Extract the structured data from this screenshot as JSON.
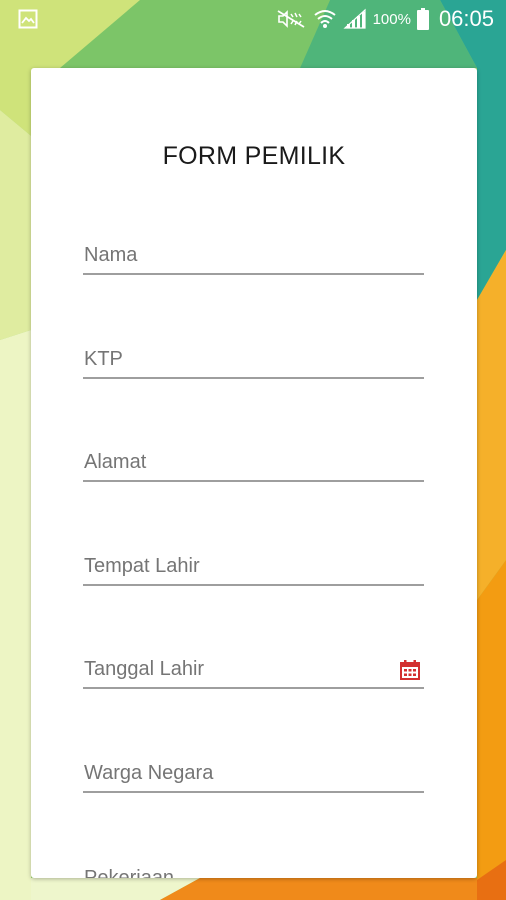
{
  "status_bar": {
    "battery_percent": "100%",
    "time": "06:05"
  },
  "form": {
    "title": "FORM PEMILIK",
    "fields": [
      {
        "placeholder": "Nama"
      },
      {
        "placeholder": "KTP"
      },
      {
        "placeholder": "Alamat"
      },
      {
        "placeholder": "Tempat Lahir"
      },
      {
        "placeholder": "Tanggal Lahir"
      },
      {
        "placeholder": "Warga Negara"
      },
      {
        "placeholder": "Pekerjaan"
      }
    ]
  },
  "icons": {
    "status_left": "image-notification-icon",
    "mute": "mute-icon",
    "wifi": "wifi-icon",
    "signal": "signal-icon",
    "battery": "battery-icon",
    "date_picker": "calendar-icon"
  },
  "colors": {
    "calendar_icon": "#d32f2f",
    "underline": "#9e9e9e",
    "placeholder": "#757575"
  }
}
